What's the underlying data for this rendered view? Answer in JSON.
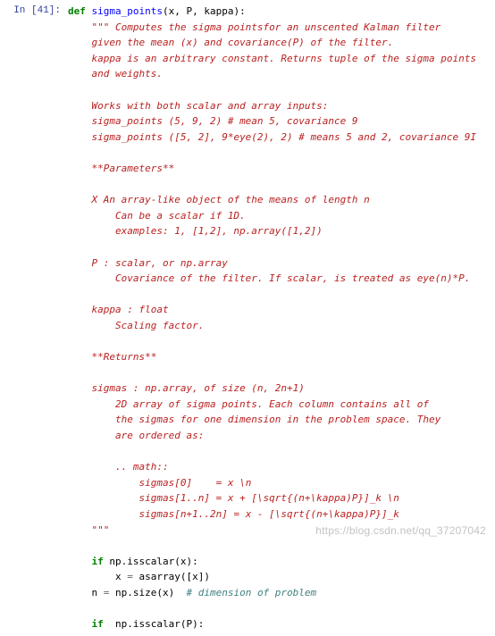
{
  "prompt": "In [41]:",
  "code": {
    "def": "def",
    "fname": "sigma_points",
    "params": "(x, P, kappa):",
    "doc0": "\"\"\" Computes the sigma pointsfor an unscented Kalman filter",
    "doc1": "given the mean (x) and covariance(P) of the filter.",
    "doc2": "kappa is an arbitrary constant. Returns tuple of the sigma points",
    "doc3": "and weights.",
    "doc4": "Works with both scalar and array inputs:",
    "doc5": "sigma_points (5, 9, 2) # mean 5, covariance 9",
    "doc6": "sigma_points ([5, 2], 9*eye(2), 2) # means 5 and 2, covariance 9I",
    "doc7": "**Parameters**",
    "doc8": "X An array-like object of the means of length n",
    "doc9": "Can be a scalar if 1D.",
    "doc10": "examples: 1, [1,2], np.array([1,2])",
    "doc11": "P : scalar, or np.array",
    "doc12": "Covariance of the filter. If scalar, is treated as eye(n)*P.",
    "doc13": "kappa : float",
    "doc14": "Scaling factor.",
    "doc15": "**Returns**",
    "doc16": "sigmas : np.array, of size (n, 2n+1)",
    "doc17": "2D array of sigma points. Each column contains all of",
    "doc18": "the sigmas for one dimension in the problem space. They",
    "doc19": "are ordered as:",
    "doc20": ".. math::",
    "doc21": "sigmas[0]    = x \\n",
    "doc22": "sigmas[1..n] = x + [\\sqrt{(n+\\kappa)P}]_k \\n",
    "doc23": "sigmas[n+1..2n] = x - [\\sqrt{(n+\\kappa)P}]_k",
    "doc24": "\"\"\"",
    "if1": "if",
    "cond1": " np.isscalar(x):",
    "assign1a": "x ",
    "eq": "=",
    "assign1b": " asarray([x])",
    "assign2a": "n ",
    "assign2b": " np.size(x)  ",
    "cmt1": "# dimension of problem",
    "if2": "if",
    "cond2": "  np.isscalar(P):"
  },
  "watermark": "https://blog.csdn.net/qq_37207042"
}
